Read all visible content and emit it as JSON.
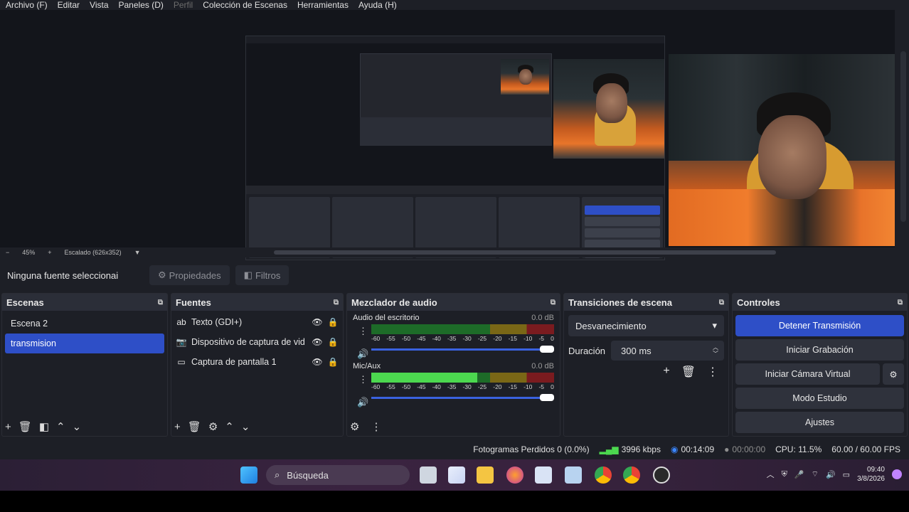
{
  "menu": {
    "items": [
      "Archivo (F)",
      "Editar",
      "Vista",
      "Paneles (D)",
      "Perfil",
      "Colección de Escenas",
      "Herramientas",
      "Ayuda (H)"
    ]
  },
  "zoom": {
    "minus": "−",
    "level": "45%",
    "plus": "+",
    "scaled": "Escalado (626x352)"
  },
  "source_bar": {
    "label": "Ninguna fuente seleccionai",
    "properties": "Propiedades",
    "filters": "Filtros"
  },
  "scenes": {
    "title": "Escenas",
    "items": [
      {
        "label": "Escena 2",
        "selected": false
      },
      {
        "label": "transmision",
        "selected": true
      }
    ]
  },
  "sources": {
    "title": "Fuentes",
    "items": [
      {
        "label": "Texto (GDI+)",
        "icon": "text-icon"
      },
      {
        "label": "Dispositivo de captura de vid",
        "icon": "camera-icon"
      },
      {
        "label": "Captura de pantalla 1",
        "icon": "monitor-icon"
      }
    ]
  },
  "mixer": {
    "title": "Mezclador de audio",
    "tracks": [
      {
        "name": "Audio del escritorio",
        "db": "0.0 dB",
        "level": 0.0
      },
      {
        "name": "Mic/Aux",
        "db": "0.0 dB",
        "level": 0.58
      }
    ],
    "scale": [
      "-60",
      "-55",
      "-50",
      "-45",
      "-40",
      "-35",
      "-30",
      "-25",
      "-20",
      "-15",
      "-10",
      "-5",
      "0"
    ]
  },
  "transitions": {
    "title": "Transiciones de escena",
    "selected": "Desvanecimiento",
    "duration_label": "Duración",
    "duration_value": "300 ms"
  },
  "controls": {
    "title": "Controles",
    "stop_stream": "Detener Transmisión",
    "start_recording": "Iniciar Grabación",
    "start_virtual_cam": "Iniciar Cámara Virtual",
    "studio_mode": "Modo Estudio",
    "settings": "Ajustes"
  },
  "status": {
    "dropped_frames": "Fotogramas Perdidos 0 (0.0%)",
    "bitrate": "3996 kbps",
    "stream_time": "00:14:09",
    "record_time": "00:00:00",
    "cpu": "CPU: 11.5%",
    "fps": "60.00 / 60.00 FPS"
  },
  "taskbar": {
    "search_placeholder": "Búsqueda",
    "time": "09:40",
    "date": "3/8/2026"
  },
  "colors": {
    "accent": "#2e4fc7",
    "panel_bg": "#1d1f26",
    "header_bg": "#2b2e38"
  }
}
